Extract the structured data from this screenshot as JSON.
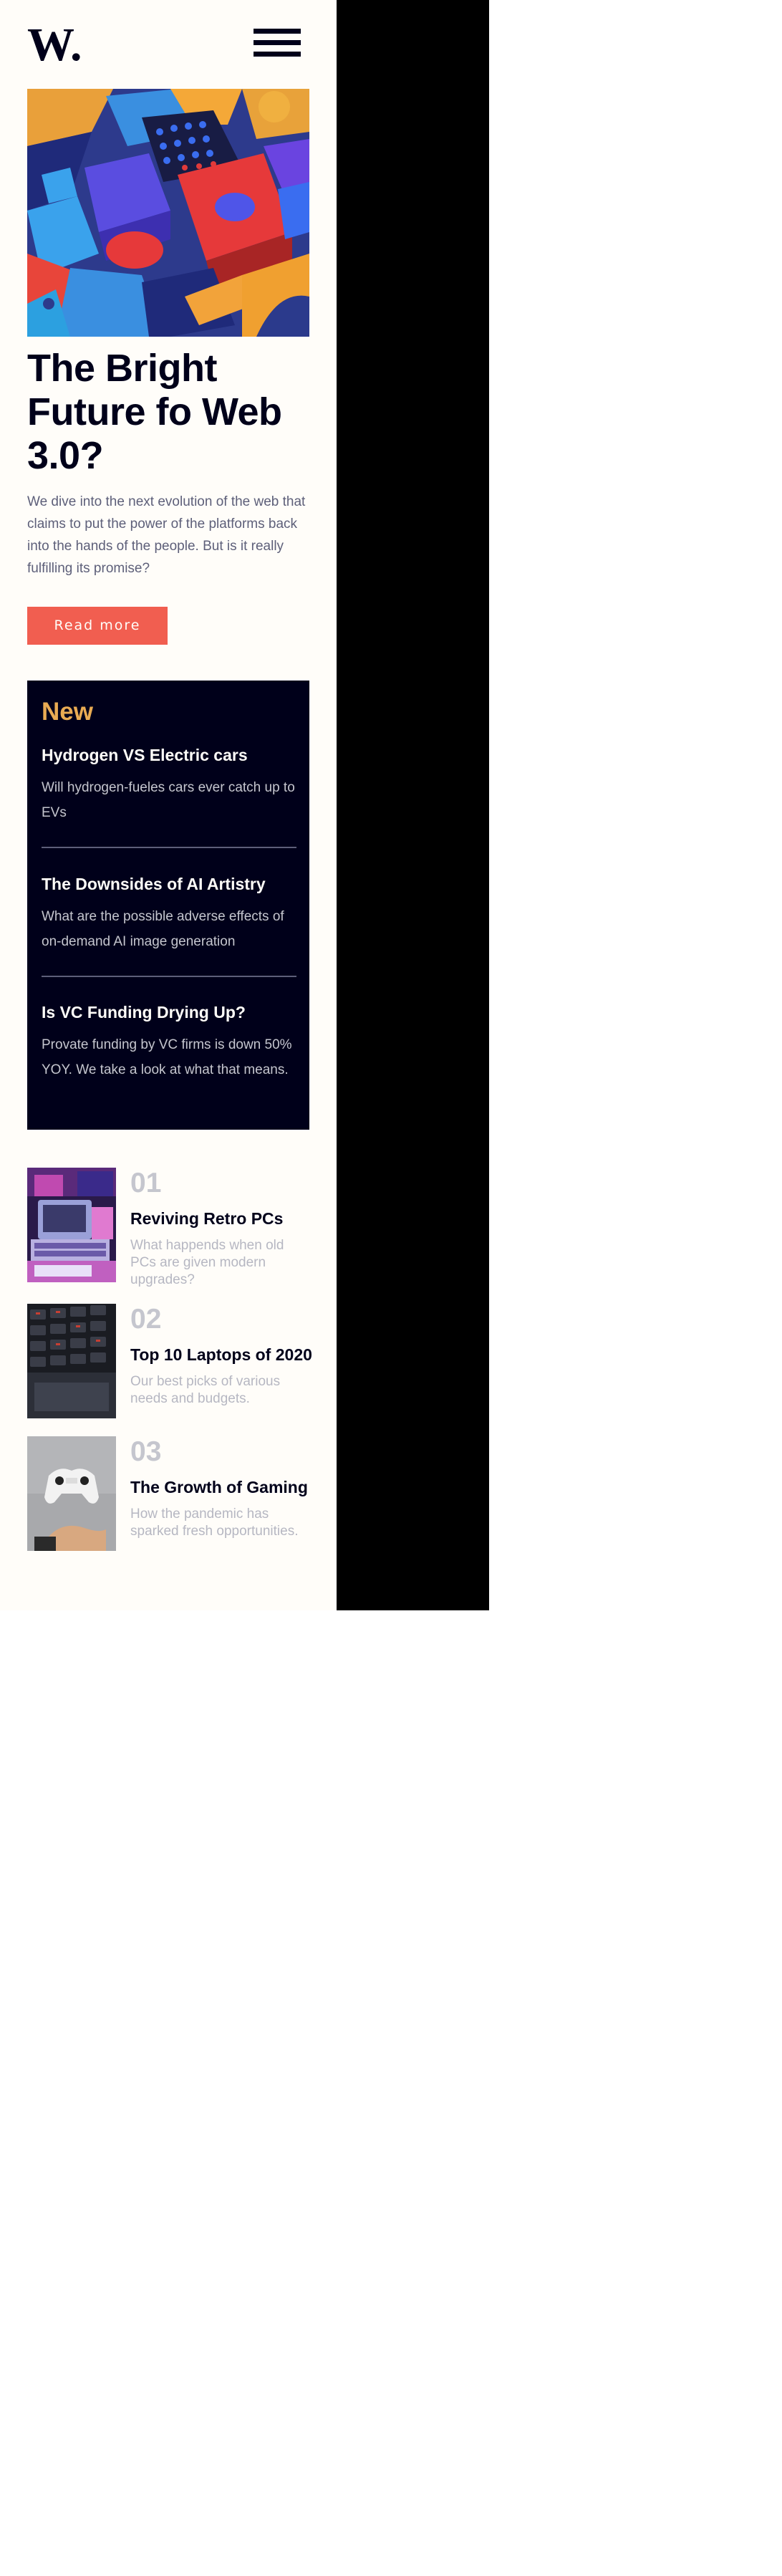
{
  "header": {
    "logo_text": "W.",
    "menu_icon": "hamburger-menu-icon"
  },
  "hero": {
    "image_icon": "abstract-3d-shapes-image",
    "title": "The Bright Future fo Web 3.0?",
    "description": "We dive into the next evolution of the web that claims to put the power of the platforms back into the hands of the people. But is it really fulfilling its promise?",
    "button_label": "Read more"
  },
  "new_section": {
    "heading": "New",
    "items": [
      {
        "title": "Hydrogen VS Electric cars",
        "description": "Will hydrogen-fueles cars ever catch up to EVs"
      },
      {
        "title": "The Downsides of AI Artistry",
        "description": "What are the possible adverse effects of on-demand AI image generation"
      },
      {
        "title": "Is VC Funding Drying Up?",
        "description": "Provate funding by VC firms is down 50% YOY. We take a look at what that means."
      }
    ]
  },
  "top_list": [
    {
      "number": "01",
      "title": "Reviving Retro PCs",
      "description": "What happends when old PCs are given modern upgrades?",
      "image_icon": "retro-pc-image"
    },
    {
      "number": "02",
      "title": "Top 10 Laptops of 2020",
      "description": "Our best picks of various needs and budgets.",
      "image_icon": "laptop-keyboard-image"
    },
    {
      "number": "03",
      "title": "The Growth of Gaming",
      "description": "How the pandemic has sparked fresh opportunities.",
      "image_icon": "gaming-controller-image"
    }
  ],
  "colors": {
    "background": "#fffdf9",
    "dark_navy": "#00001a",
    "accent_red": "#f15e50",
    "accent_orange": "#e9ab53",
    "muted_text": "#5d5f79",
    "light_grey": "#c5c6ce"
  }
}
